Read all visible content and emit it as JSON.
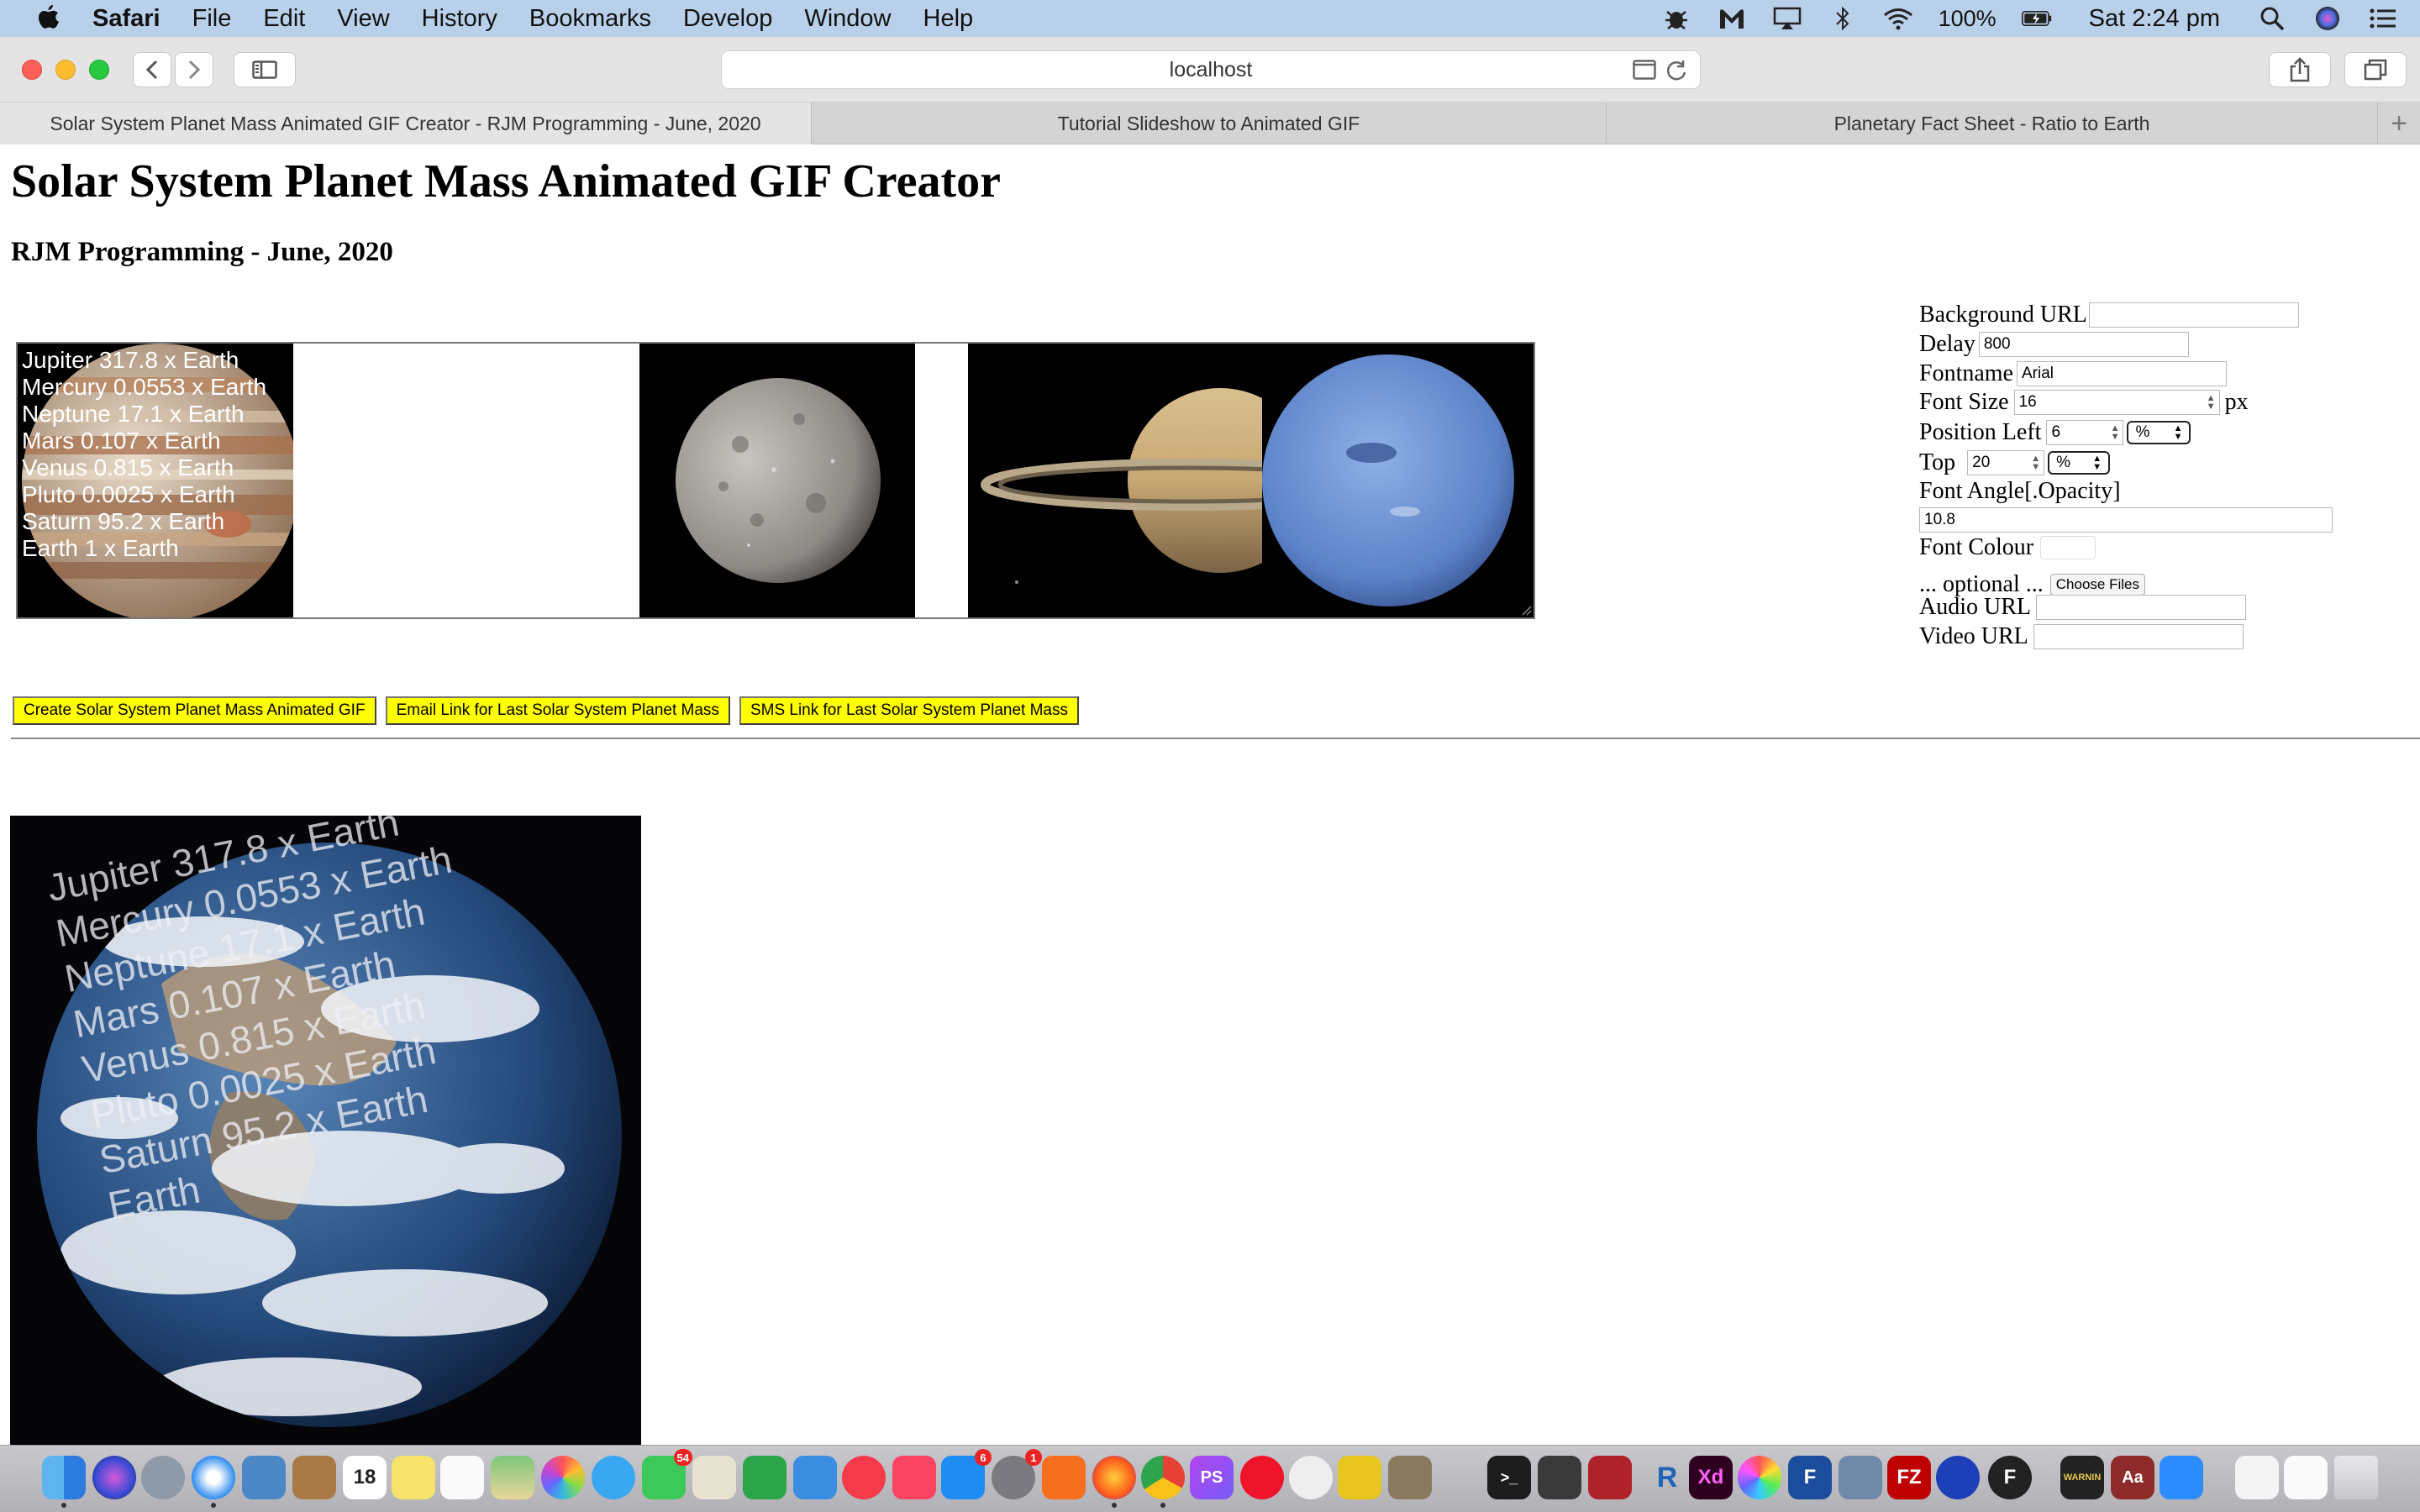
{
  "menubar": {
    "app_name": "Safari",
    "items": [
      "File",
      "Edit",
      "View",
      "History",
      "Bookmarks",
      "Develop",
      "Window",
      "Help"
    ],
    "battery": "100%",
    "clock": "Sat 2:24 pm",
    "status_icons": [
      "bug-icon",
      "malwarebytes-icon",
      "airplay-icon",
      "bluetooth-icon",
      "wifi-icon",
      "battery-icon",
      "search-icon",
      "siri-icon",
      "list-icon"
    ]
  },
  "toolbar": {
    "url": "localhost"
  },
  "tabs": [
    {
      "label": "Solar System Planet Mass Animated GIF Creator - RJM Programming - June, 2020",
      "active": true
    },
    {
      "label": "Tutorial Slideshow to Animated GIF",
      "active": false
    },
    {
      "label": "Planetary Fact Sheet - Ratio to Earth",
      "active": false
    }
  ],
  "page": {
    "title": "Solar System Planet Mass Animated GIF Creator",
    "subtitle": "RJM Programming - June, 2020",
    "overlay_lines": [
      "Jupiter 317.8 x Earth",
      "Mercury 0.0553 x Earth",
      "Neptune 17.1 x Earth",
      "Mars 0.107 x Earth",
      "Venus 0.815 x Earth",
      "Pluto 0.0025 x Earth",
      "Saturn 95.2 x Earth",
      "Earth 1 x Earth"
    ],
    "form": {
      "background_url_label": "Background URL",
      "background_url_value": "",
      "delay_label": "Delay",
      "delay_value": "800",
      "fontname_label": "Fontname",
      "fontname_value": "Arial",
      "fontsize_label": "Font Size",
      "fontsize_value": "16",
      "fontsize_unit": "px",
      "position_left_label": "Position Left",
      "position_left_value": "6",
      "position_left_unit": "%",
      "top_label": "Top",
      "top_value": "20",
      "top_unit": "%",
      "font_angle_label": "Font Angle[.Opacity]",
      "font_angle_value": "10.8",
      "font_colour_label": "Font Colour",
      "optional_label": "... optional ...",
      "choose_files_label": "Choose Files",
      "audio_url_label": "Audio URL",
      "audio_url_value": "",
      "video_url_label": "Video URL",
      "video_url_value": ""
    },
    "buttons": {
      "create": "Create Solar System Planet Mass Animated GIF",
      "email": "Email Link for Last Solar System Planet Mass",
      "sms": "SMS Link for Last Solar System Planet Mass"
    },
    "earth_overlay_lines": [
      "Jupiter 317.8 x Earth",
      "Mercury 0.0553 x Earth",
      "Neptune 17.1 x Earth",
      "Mars 0.107 x Earth",
      "Venus 0.815 x Earth",
      "Pluto 0.0025 x Earth",
      "Saturn 95.2 x Earth",
      "Earth"
    ]
  },
  "dock": {
    "badges": {
      "mail": "54",
      "appstore": "6",
      "preferences": "1"
    },
    "items": [
      "finder-icon",
      "siri-icon",
      "launchpad-icon",
      "safari-icon",
      "preview-icon",
      "notes-icon",
      "calendar-icon",
      "stickies-icon",
      "reminders-icon",
      "maps-icon",
      "photos-icon",
      "messages-icon",
      "facetime-icon",
      "textedit-icon",
      "numbers-icon",
      "keynote-icon",
      "news-icon",
      "music-icon",
      "appstore-icon",
      "preferences-icon",
      "avast-icon",
      "firefox-icon",
      "chrome-icon",
      "phpstorm-icon",
      "opera-icon",
      "android-icon",
      "webex-icon",
      "gimp-icon",
      "terminal-icon",
      "inkscape-icon",
      "photobooth-icon",
      "r-icon",
      "xd-icon",
      "colorsync-icon",
      "fontforge-icon",
      "screenshot-icon",
      "filezilla-icon",
      "audacity-icon",
      "fcode-icon",
      "console-icon",
      "dictionary-icon",
      "zoom-icon",
      "document-icon",
      "opera-doc-icon",
      "trash-icon"
    ],
    "calendar_day": "18",
    "xd_label": "Xd",
    "ps_label": "PS",
    "r_label": "R",
    "fz_label": "FZ",
    "f_label": "F",
    "aa_label": "Aa",
    "warning_label": "WARNIN"
  }
}
